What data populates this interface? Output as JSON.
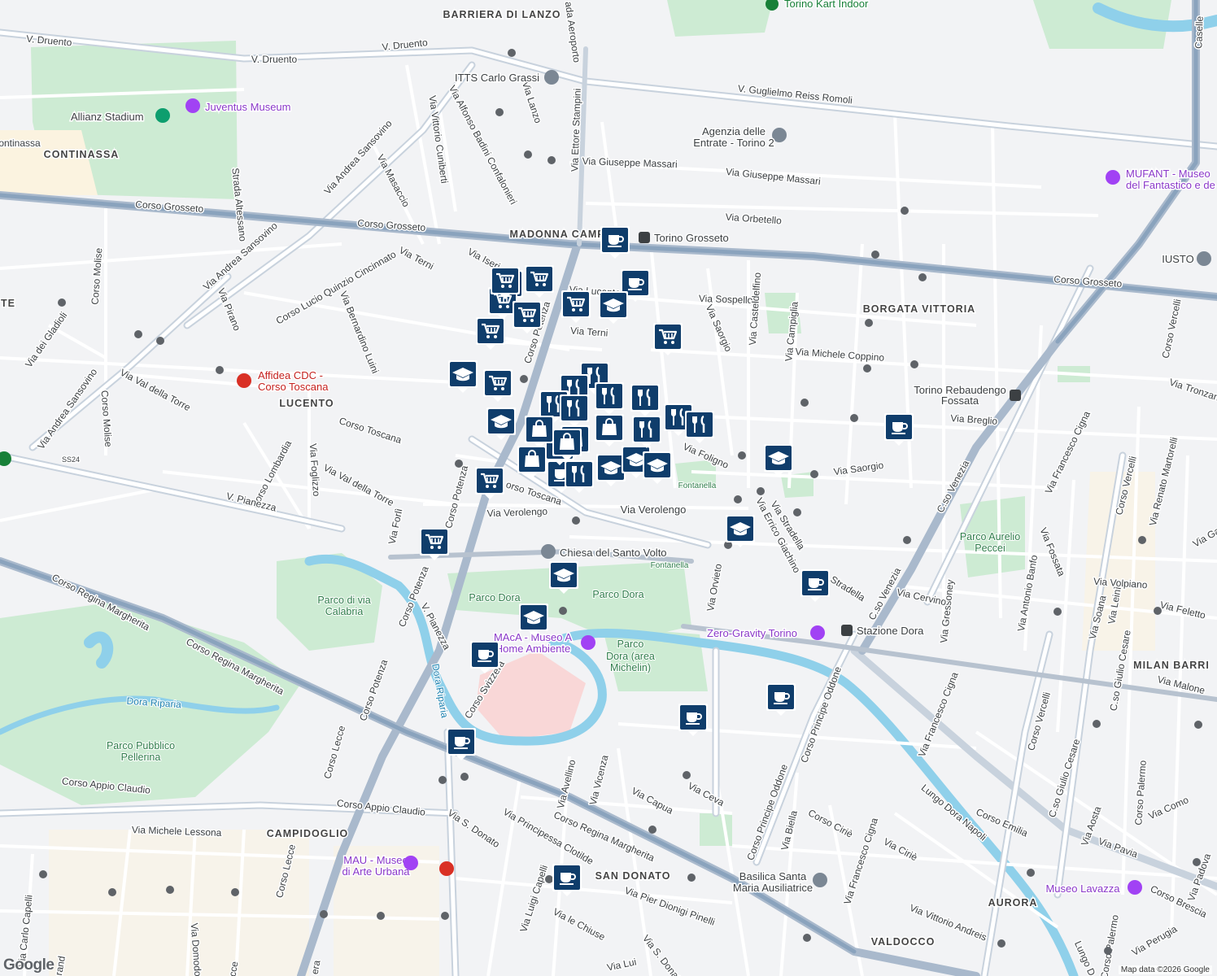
{
  "map": {
    "footer": "Map data ©2026 Google",
    "logo": "Google",
    "colors": {
      "background": "#f2f3f5",
      "park": "#cdebd3",
      "water": "#8fd0ea",
      "road": "#ffffff",
      "major_road": "#aebccd",
      "rail": "#8aa3bd",
      "marker": "#0f3d6b"
    }
  },
  "areas": [
    "BARRIERA DI LANZO",
    "CONTINASSA",
    "LUCENTO",
    "BORGATA VITTORIA",
    "CAMPIDOGLIO",
    "SAN DONATO",
    "AURORA",
    "VALDOCCO",
    "MILAN BARRI",
    "MADONNA CAMPAGN",
    "TE"
  ],
  "pois": {
    "torino_kart": "Torino Kart Indoor",
    "itts": "ITTS Carlo Grassi",
    "juventus": "Juventus Museum",
    "allianz": "Allianz Stadium",
    "agenzia1": "Agenzia delle",
    "agenzia2": "Entrate - Torino 2",
    "mufant1": "MUFANT - Museo",
    "mufant2": "del Fantastico e de",
    "iusto": "IUSTO",
    "torino_grosseto": "Torino Grosseto",
    "affidea1": "Affidea CDC -",
    "affidea2": "Corso Toscana",
    "rebaudengo1": "Torino Rebaudengo",
    "rebaudengo2": "Fossata",
    "chiesa": "Chiesa del Santo Volto",
    "zero_gravity": "Zero-Gravity Torino",
    "stazione_dora": "Stazione Dora",
    "maca1": "MAcA - Museo A",
    "maca2": "Home Ambiente",
    "mau1": "MAU - Museo",
    "mau2": "di Arte Urbana",
    "basilica1": "Basilica Santa",
    "basilica2": "Maria Ausiliatrice",
    "lavazza": "Museo Lavazza"
  },
  "parks": {
    "parco_dora_a": "Parco Dora",
    "parco_dora_b": "Parco Dora",
    "parco_michelin1": "Parco",
    "parco_michelin2": "Dora (area",
    "parco_michelin3": "Michelin)",
    "calabria1": "Parco di via",
    "calabria2": "Calabria",
    "pellerina1": "Parco Pubblico",
    "pellerina2": "Pellerina",
    "peccei1": "Parco Aurelio",
    "peccei2": "Peccei",
    "fontanella1": "Fontanella",
    "fontanella2": "Fontanella"
  },
  "water": {
    "dora_riparia1": "Dora Riparia",
    "dora_riparia2": "Dora Riparia"
  },
  "streets": {
    "v_druento1": "V. Druento",
    "v_druento2": "V. Druento",
    "v_druento3": "V. Druento",
    "via_aeroporto": "ada Aeroporto",
    "reiss": "V. Guglielmo Reiss Romoli",
    "via_lanzo": "Via Lanzo",
    "via_stampini": "Via Ettore Stampini",
    "massari1": "Via Giuseppe Massari",
    "massari2": "Via Giuseppe Massari",
    "orbetello": "Via Orbetello",
    "grosseto1": "Corso Grosseto",
    "grosseto2": "Corso Grosseto",
    "grosseto3": "Corso Grosseto",
    "sansovino1": "Via Andrea Sansovino",
    "sansovino2": "Via Andrea Sansovino",
    "sansovino3": "Via Andrea Sansovino",
    "altessano": "Strada Altessano",
    "continassa": "ontinassa",
    "masaccio": "Via Masaccio",
    "cuniberti": "Via Vittorio Cuniberti",
    "badini": "Via Alfonso Badini Confalonieri",
    "terni1": "Via Terni",
    "terni2": "Via Terni",
    "iseri": "Via Iseri",
    "lucento": "Via Lucento",
    "cincinnato": "Corso Lucio Quinzio Cincinnato",
    "luini": "Via Bernardino Luini",
    "pirano": "Via Pirano",
    "molise1": "Corso Molise",
    "molise2": "Corso Molise",
    "gladioli": "Via dei Gladioli",
    "val_torre1": "Via Val della Torre",
    "val_torre2": "Via Val della Torre",
    "potenza1": "Corso Potenza",
    "potenza2": "Corso Potenza",
    "potenza3": "Corso Potenza",
    "potenza4": "Corso Potenza",
    "toscana1": "Corso Toscana",
    "toscana2": "orso Toscana",
    "sospello": "Via Sospello",
    "saorgio1": "Via Saorgio",
    "saorgio2": "Via Saorgio",
    "casteldelfino": "Via Casteldelfino",
    "campiglia": "Via Campiglia",
    "coppino": "Via Michele Coppino",
    "breglio": "Via Breglio",
    "tronzano": "Via Tronzano",
    "foligno": "Via Foligno",
    "verolengo1": "Via Verolengo",
    "verolengo2": "Via Verolengo",
    "foglizzo": "Via Foglizzo",
    "lombardia": "Corso Lombardia",
    "pianezza1": "V. Pianezza",
    "pianezza2": "V. Pianezza",
    "forli": "Via Forlì",
    "ss24": "SS24",
    "stradella1": "Via Stradella",
    "stradella2": "Stradella",
    "giachino": "Via Errico Giachino",
    "orvieto": "Via Orvieto",
    "venezia1": "C.so Venezia",
    "venezia2": "C.so Venezia",
    "cigna1": "Via Francesco Cigna",
    "cigna2": "Via Francesco Cigna",
    "cigna3": "Via Francesco Cigna",
    "vercelli1": "Corso Vercelli",
    "vercelli2": "Corso Vercelli",
    "vercelli3": "Corso Vercelli",
    "martorelli": "Via Renato Martorelli",
    "fossata": "Via Fossata",
    "banfo": "Via Antonio Banfo",
    "gressoney": "Via Gressoney",
    "cervino": "Via Cervino",
    "volpiano": "Via Volpiano",
    "feletto": "Via Feletto",
    "soana": "Via Soana",
    "leini": "Via Leinì",
    "cesare1": "C.so Giulio Cesare",
    "cesare2": "C.so Giulio Cesare",
    "malone": "Via Malone",
    "ga": "Via Ga",
    "casella": "Caselle",
    "regina1": "Corso Regina Margherita",
    "regina2": "Corso Regina Margherita",
    "regina3": "Corso Regina Margherita",
    "svizzera": "Corso Svizzera",
    "lecce1": "Corso Lecce",
    "lecce2": "Corso Lecce",
    "appio1": "Corso Appio Claudio",
    "appio2": "Corso Appio Claudio",
    "lessona": "Via Michele Lessona",
    "avellino": "Via Avellino",
    "vicenza": "Via Vicenza",
    "capua": "Via Capua",
    "ceva": "Via Ceva",
    "oddone1": "Corso Principe Oddone",
    "oddone2": "Corso Principe Oddone",
    "biella": "Via Biella",
    "cirie1": "Corso Ciriè",
    "cirie2": "Via Ciriè",
    "dora_napoli": "Lungo Dora Napoli",
    "emilia": "Corso Emilia",
    "aosta": "Via Aosta",
    "pavia": "Via Pavia",
    "como": "Via Como",
    "palermo1": "Corso Palermo",
    "palermo2": "Corso Palermo",
    "brescia": "Corso Brescia",
    "perugia": "Via Perugia",
    "padova": "Via Padova",
    "andreis": "Via Vittorio Andreis",
    "pinelli": "Via Pier Dionigi Pinelli",
    "s_donato1": "Via S. Donato",
    "s_donato2": "Via S. Donat",
    "clotilde": "Via Principessa Clotilde",
    "chiuse": "Via le Chiuse",
    "luigi1": "Via Luigi Capelli",
    "luigi2": "Via Lui",
    "capelli": "Via Carlo Capelli",
    "domodossola": "Via Domodo",
    "lungo_dora": "Lungo D",
    "grand": "rand",
    "era": "era",
    "cce": "cce",
    "v_pianezza_s": "V. Pianezza"
  },
  "markers": [
    {
      "type": "coffee"
    },
    {
      "type": "coffee"
    },
    {
      "type": "coffee"
    },
    {
      "type": "coffee"
    },
    {
      "type": "coffee"
    },
    {
      "type": "coffee"
    },
    {
      "type": "coffee"
    },
    {
      "type": "coffee"
    },
    {
      "type": "coffee"
    },
    {
      "type": "coffee"
    },
    {
      "type": "coffee"
    },
    {
      "type": "grocery"
    },
    {
      "type": "grocery"
    },
    {
      "type": "grocery"
    },
    {
      "type": "grocery"
    },
    {
      "type": "grocery"
    },
    {
      "type": "grocery"
    },
    {
      "type": "grocery"
    },
    {
      "type": "grocery"
    },
    {
      "type": "grocery"
    },
    {
      "type": "grocery"
    },
    {
      "type": "grocery"
    },
    {
      "type": "school"
    },
    {
      "type": "school"
    },
    {
      "type": "school"
    },
    {
      "type": "school"
    },
    {
      "type": "school"
    },
    {
      "type": "school"
    },
    {
      "type": "school"
    },
    {
      "type": "school"
    },
    {
      "type": "school"
    },
    {
      "type": "school"
    },
    {
      "type": "restaurant"
    },
    {
      "type": "restaurant"
    },
    {
      "type": "restaurant"
    },
    {
      "type": "restaurant"
    },
    {
      "type": "restaurant"
    },
    {
      "type": "restaurant"
    },
    {
      "type": "restaurant"
    },
    {
      "type": "restaurant"
    },
    {
      "type": "restaurant"
    },
    {
      "type": "restaurant"
    },
    {
      "type": "shopping"
    },
    {
      "type": "shopping"
    },
    {
      "type": "shopping"
    },
    {
      "type": "shopping"
    },
    {
      "type": "shopping"
    }
  ]
}
